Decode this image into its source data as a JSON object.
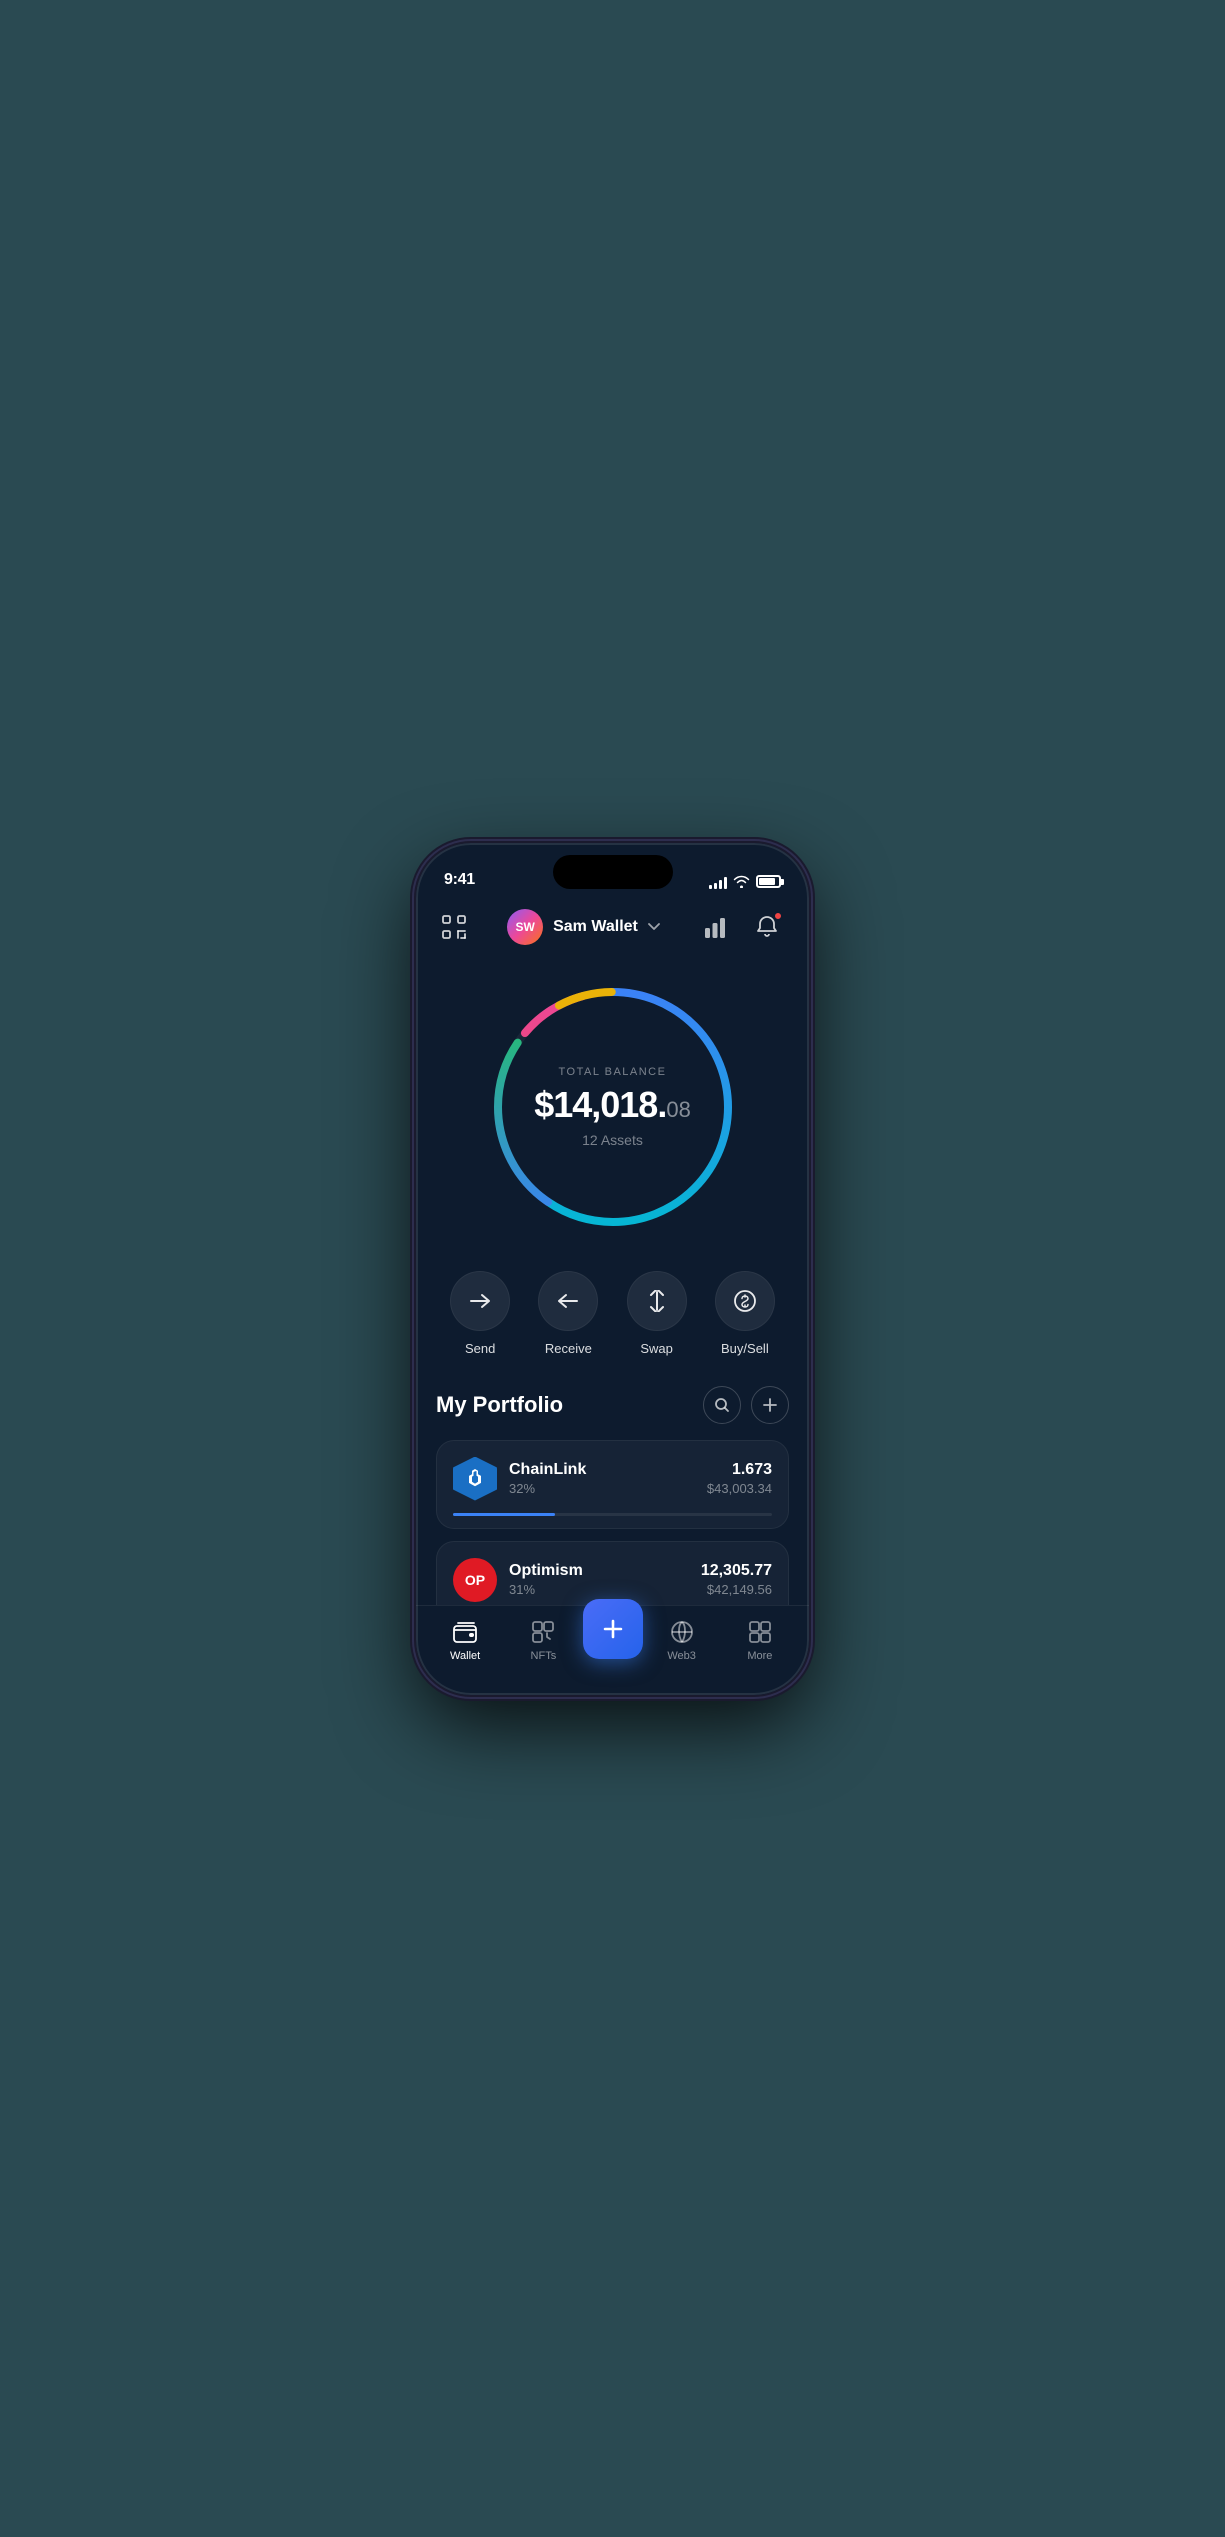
{
  "statusBar": {
    "time": "9:41",
    "signalBars": [
      4,
      6,
      8,
      10,
      12
    ],
    "batteryLevel": 85
  },
  "header": {
    "avatarText": "SW",
    "walletName": "Sam Wallet",
    "scanLabel": "scan",
    "chartLabel": "chart",
    "bellLabel": "notifications"
  },
  "balance": {
    "label": "TOTAL BALANCE",
    "dollars": "$14,018.",
    "cents": "08",
    "assetsCount": "12 Assets"
  },
  "actions": [
    {
      "id": "send",
      "label": "Send"
    },
    {
      "id": "receive",
      "label": "Receive"
    },
    {
      "id": "swap",
      "label": "Swap"
    },
    {
      "id": "buysell",
      "label": "Buy/Sell"
    }
  ],
  "portfolio": {
    "title": "My Portfolio",
    "searchLabel": "search",
    "addLabel": "add",
    "assets": [
      {
        "id": "chainlink",
        "name": "ChainLink",
        "percent": "32%",
        "amount": "1.673",
        "value": "$43,003.34",
        "progressClass": "chainlink-progress",
        "iconClass": "chainlink-icon",
        "iconText": ""
      },
      {
        "id": "optimism",
        "name": "Optimism",
        "percent": "31%",
        "amount": "12,305.77",
        "value": "$42,149.56",
        "progressClass": "optimism-progress",
        "iconClass": "optimism-icon",
        "iconText": "OP"
      }
    ]
  },
  "bottomNav": [
    {
      "id": "wallet",
      "label": "Wallet",
      "active": true
    },
    {
      "id": "nfts",
      "label": "NFTs",
      "active": false
    },
    {
      "id": "fab",
      "label": "",
      "active": false,
      "isFab": true
    },
    {
      "id": "web3",
      "label": "Web3",
      "active": false
    },
    {
      "id": "more",
      "label": "More",
      "active": false
    }
  ],
  "colors": {
    "bg": "#0d1b2e",
    "accent": "#2563eb",
    "cardBg": "rgba(255,255,255,0.04)"
  }
}
